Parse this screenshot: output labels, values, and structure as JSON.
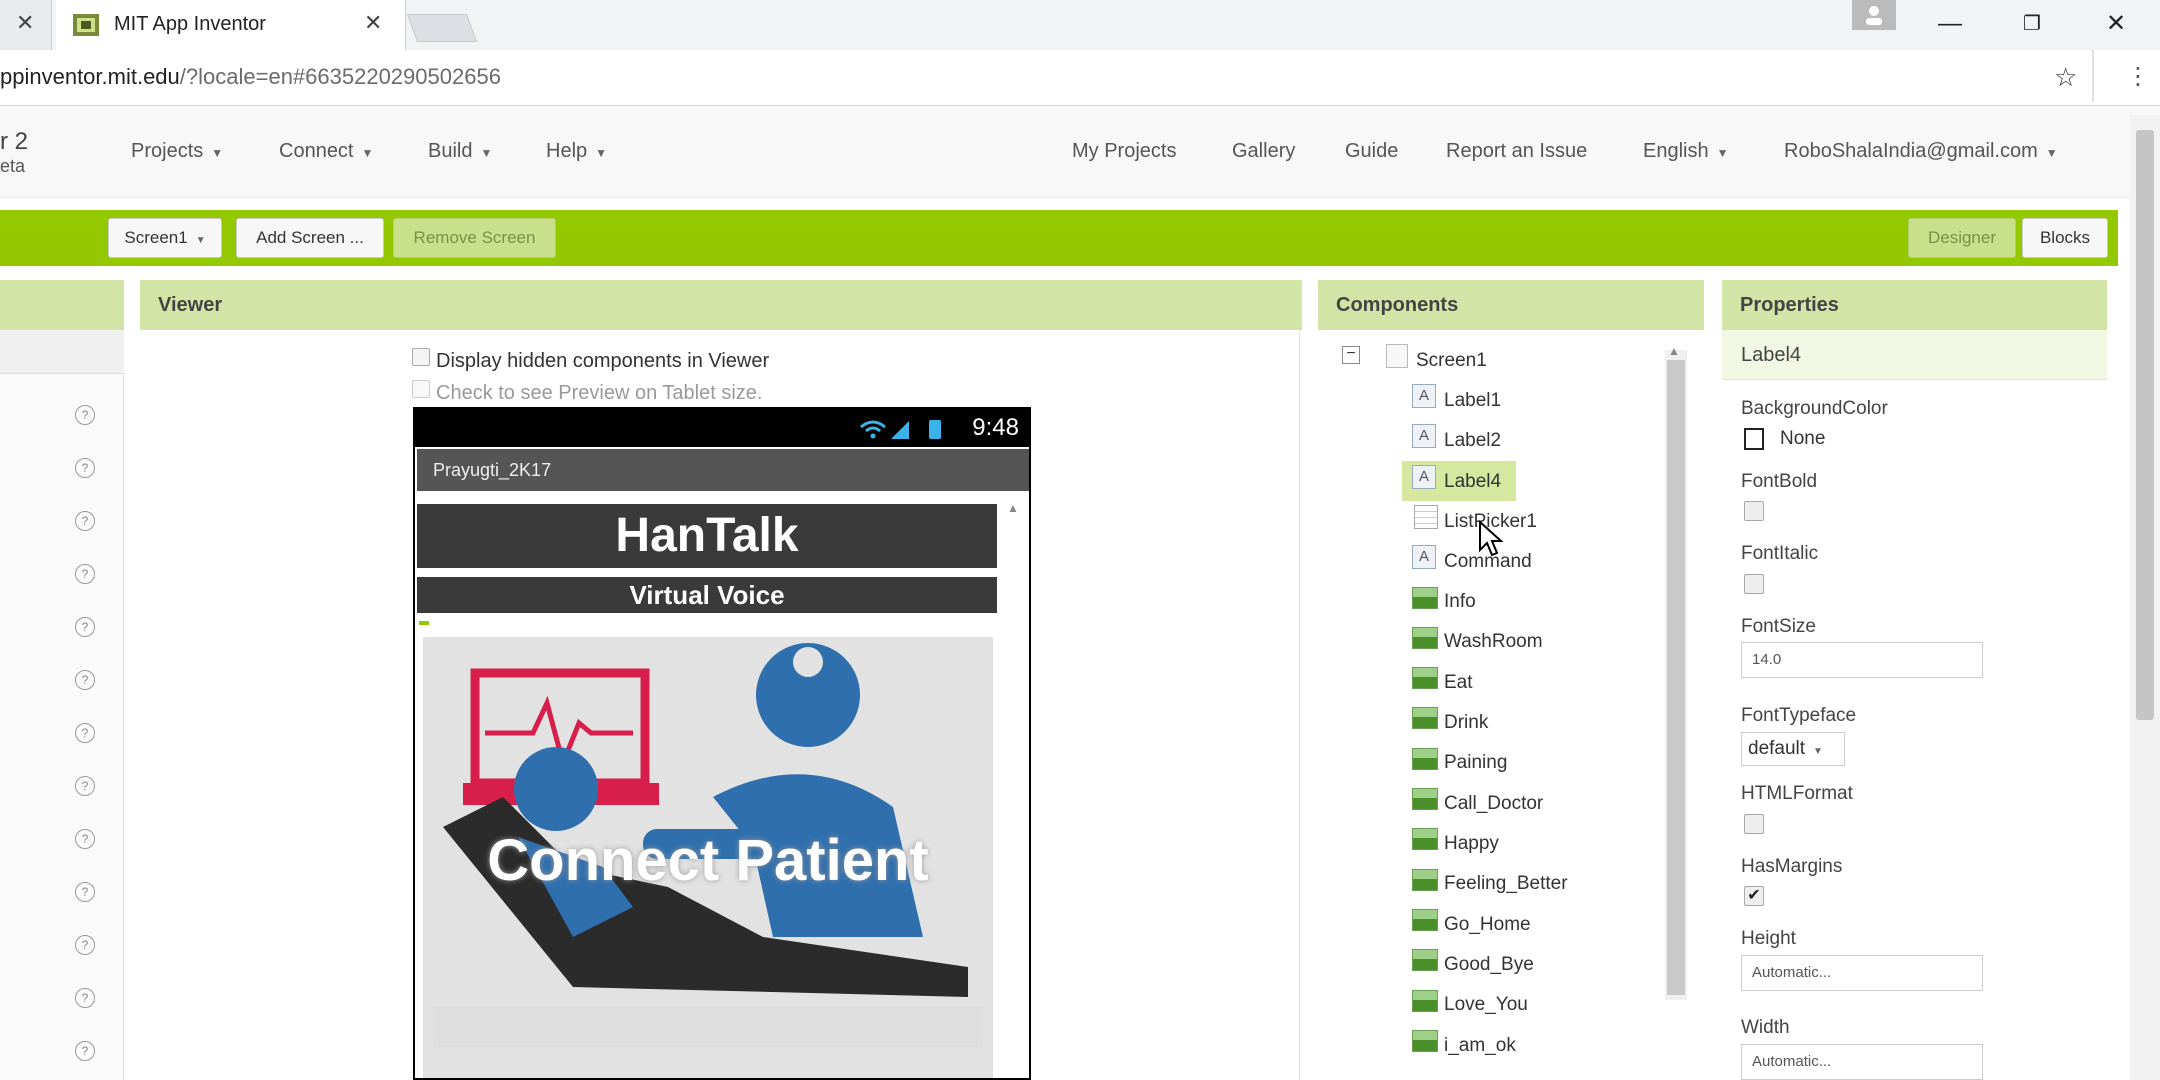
{
  "browser": {
    "tab_title": "MIT App Inventor",
    "url_host": "ppinventor.mit.edu",
    "url_rest": "/?locale=en#6635220290502656"
  },
  "header": {
    "brand_line1": "r 2",
    "brand_line2": "eta",
    "menus": [
      "Projects",
      "Connect",
      "Build",
      "Help"
    ],
    "right_links": [
      "My Projects",
      "Gallery",
      "Guide",
      "Report an Issue"
    ],
    "language": "English",
    "account": "RoboShalaIndia@gmail.com"
  },
  "toolbar": {
    "screen_select": "Screen1",
    "add_screen": "Add Screen ...",
    "remove_screen": "Remove Screen",
    "designer": "Designer",
    "blocks": "Blocks"
  },
  "viewer": {
    "title": "Viewer",
    "display_hidden": "Display hidden components in Viewer",
    "tablet_preview": "Check to see Preview on Tablet size.",
    "phone_time": "9:48",
    "screen_title": "Prayugti_2K17",
    "app_title": "HanTalk",
    "app_subtitle": "Virtual Voice",
    "hero_text": "Connect Patient"
  },
  "components": {
    "title": "Components",
    "root": "Screen1",
    "items": [
      "Label1",
      "Label2",
      "Label4",
      "ListPicker1",
      "Command",
      "Info",
      "WashRoom",
      "Eat",
      "Drink",
      "Paining",
      "Call_Doctor",
      "Happy",
      "Feeling_Better",
      "Go_Home",
      "Good_Bye",
      "Love_You",
      "i_am_ok"
    ],
    "selected": "Label4"
  },
  "properties": {
    "title": "Properties",
    "component": "Label4",
    "background_color_label": "BackgroundColor",
    "background_color_value": "None",
    "fontbold_label": "FontBold",
    "fontitalic_label": "FontItalic",
    "fontsize_label": "FontSize",
    "fontsize_value": "14.0",
    "fonttypeface_label": "FontTypeface",
    "fonttypeface_value": "default",
    "htmlformat_label": "HTMLFormat",
    "hasmargins_label": "HasMargins",
    "height_label": "Height",
    "height_value": "Automatic...",
    "width_label": "Width",
    "width_value": "Automatic..."
  },
  "colors": {
    "toolbar_green": "#94c800",
    "panel_header": "#d3e5a6",
    "selected_item": "#d6e8a0"
  }
}
